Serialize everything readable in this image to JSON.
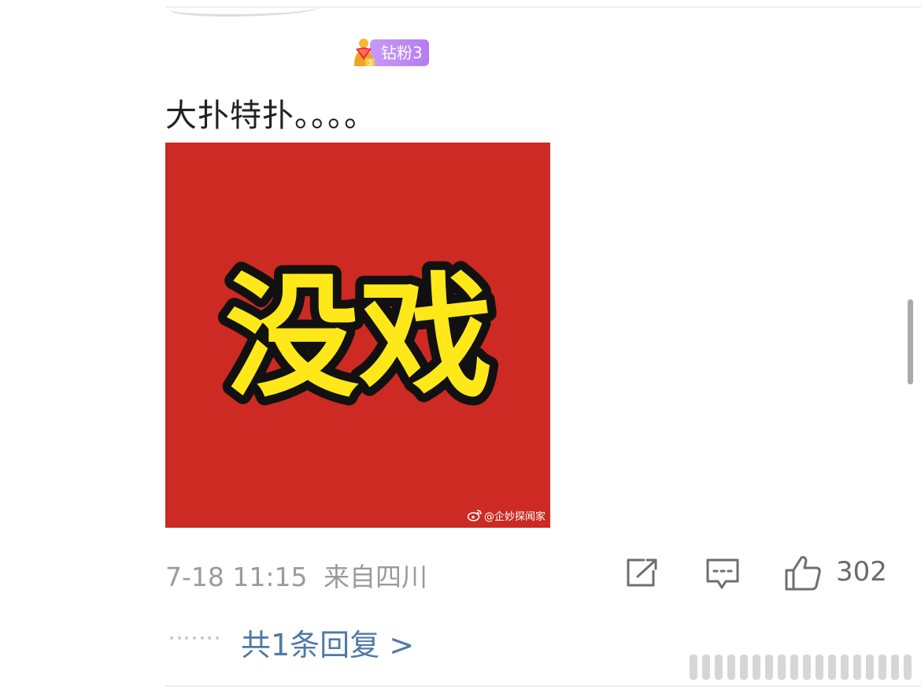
{
  "badge": {
    "label": "钻粉3",
    "icon": "diamond-fan-level-icon"
  },
  "comment": {
    "text": "大扑特扑。。。。"
  },
  "image": {
    "main_text": "没戏",
    "watermark": "@企妙探闻家",
    "background_color": "#cc2a22",
    "text_color": "#ffe81a"
  },
  "meta": {
    "timestamp": "7-18 11:15",
    "location": "来自四川"
  },
  "actions": {
    "share_icon": "share-icon",
    "comment_icon": "comment-icon",
    "like_icon": "thumbs-up-icon",
    "like_count": "302"
  },
  "replies": {
    "link_text": "共1条回复 >"
  }
}
